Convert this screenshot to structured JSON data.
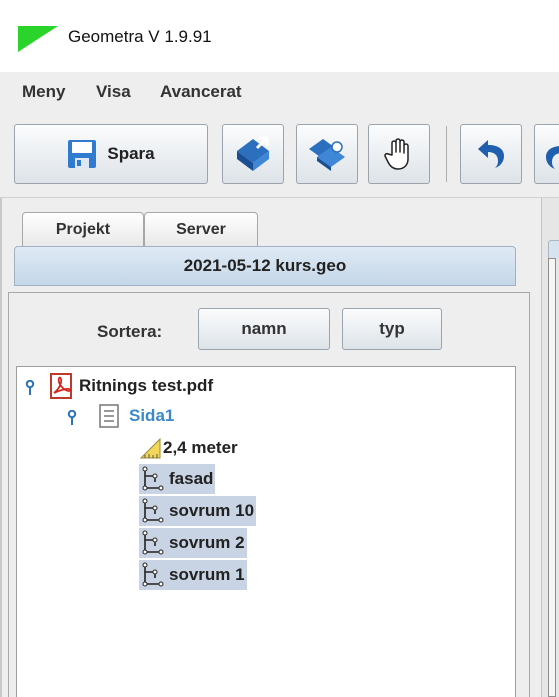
{
  "window": {
    "title": "Geometra V 1.9.91",
    "logo_color": "#2bd42b"
  },
  "menu": {
    "items": [
      "Meny",
      "Visa",
      "Avancerat"
    ]
  },
  "toolbar": {
    "save_label": "Spara",
    "icons": [
      "save-icon",
      "import-icon",
      "export-icon",
      "pan-hand-icon",
      "undo-icon",
      "redo-icon"
    ]
  },
  "tabs": {
    "projekt": "Projekt",
    "server": "Server"
  },
  "file": {
    "name": "2021-05-12 kurs.geo"
  },
  "sort": {
    "label": "Sortera:",
    "by_name": "namn",
    "by_type": "typ"
  },
  "tree": {
    "document": "Ritnings test.pdf",
    "page": "Sida1",
    "scale": "2,4 meter",
    "items": [
      "fasad",
      "sovrum 10",
      "sovrum 2",
      "sovrum 1"
    ]
  },
  "colors": {
    "selection": "#c8d3e3",
    "page_link": "#3d89c8",
    "handle": "#2c73b5"
  }
}
